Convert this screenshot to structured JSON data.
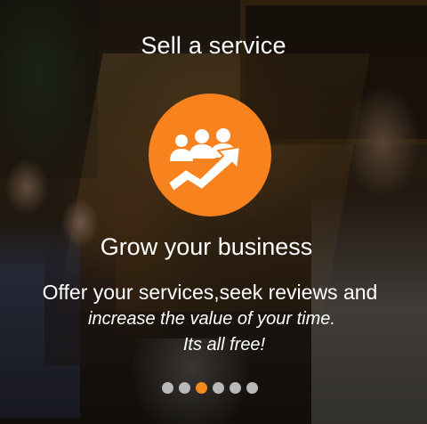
{
  "slide": {
    "title": "Sell a service",
    "headline": "Grow your business",
    "description_line1": "Offer your services,seek reviews and",
    "description_line2": "increase the value of your time.",
    "description_line3": "Its all free!",
    "logo_icon": "business-growth-icon",
    "accent_color": "#f7821e"
  },
  "pagination": {
    "total": 6,
    "active_index": 2,
    "active_color": "#f28a1e",
    "inactive_color": "#b9b9b9"
  }
}
